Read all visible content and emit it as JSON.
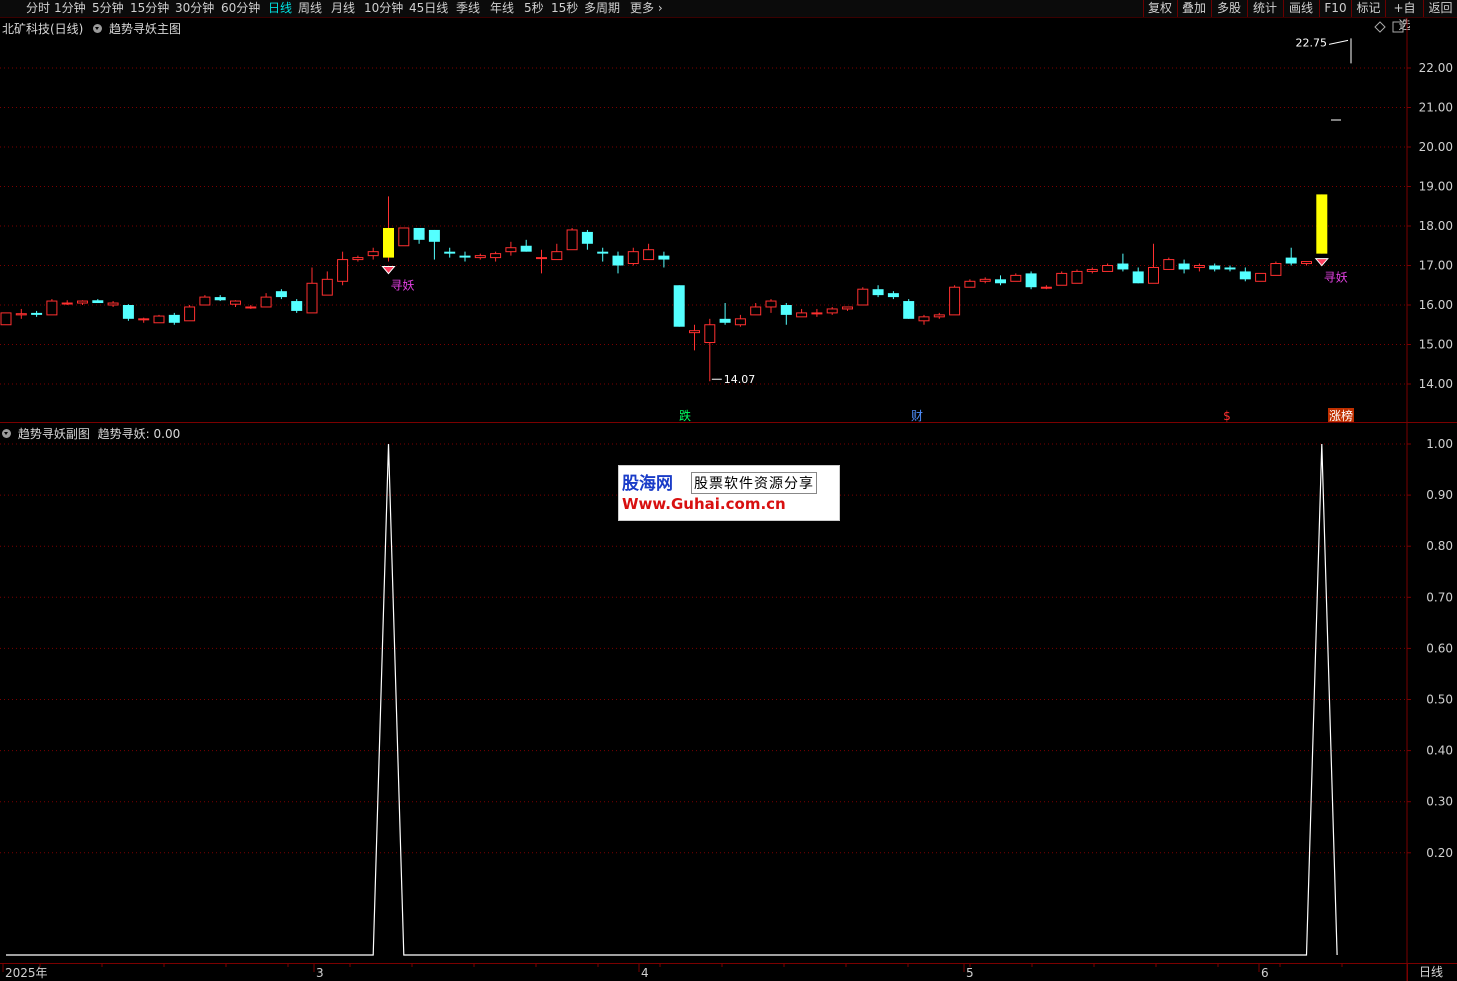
{
  "toolbar": {
    "periods": [
      "分时",
      "1分钟",
      "5分钟",
      "15分钟",
      "30分钟",
      "60分钟",
      "日线",
      "周线",
      "月线",
      "10分钟",
      "45日线",
      "季线",
      "年线",
      "5秒",
      "15秒",
      "多周期",
      "更多"
    ],
    "active_period": "日线",
    "right_buttons": [
      "复权",
      "叠加",
      "多股",
      "统计",
      "画线",
      "F10",
      "标记",
      "+自选",
      "返回"
    ]
  },
  "main_pane": {
    "stock": "北矿科技(日线)",
    "indicator": "趋势寻妖主图",
    "price_axis": [
      "22.00",
      "21.00",
      "20.00",
      "19.00",
      "18.00",
      "17.00",
      "16.00",
      "15.00",
      "14.00"
    ],
    "max_label": "22.75",
    "min_label": "14.07",
    "signal_label": "寻妖",
    "event_markers": [
      "跌",
      "财",
      "$",
      "涨榜"
    ]
  },
  "sub_pane": {
    "indicator": "趋势寻妖副图",
    "value_label": "趋势寻妖: 0.00",
    "value_axis": [
      "1.00",
      "0.90",
      "0.80",
      "0.70",
      "0.60",
      "0.50",
      "0.40",
      "0.30",
      "0.20"
    ]
  },
  "date_axis": [
    "2025年",
    "3",
    "4",
    "5",
    "6"
  ],
  "period_label": "日线",
  "watermark": {
    "brand": "股海网",
    "slogan": "股票软件资源分享",
    "url": "Www.Guhai.com.cn"
  },
  "colors": {
    "up": "#ff3030",
    "down": "#54ffff",
    "signal": "#ffff00",
    "line": "#ffffff",
    "grid": "#7a0000"
  },
  "chart_data": {
    "type": "candlestick",
    "x": [
      "c1",
      "c2",
      "c3",
      "c4",
      "c5",
      "c6",
      "c7",
      "c8",
      "c9",
      "c10",
      "c11",
      "c12",
      "c13",
      "c14",
      "c15",
      "c16",
      "c17",
      "c18",
      "c19",
      "c20",
      "c21",
      "c22",
      "c23",
      "c24",
      "c25",
      "c26",
      "c27",
      "c28",
      "c29",
      "c30",
      "c31",
      "c32",
      "c33",
      "c34",
      "c35",
      "c36",
      "c37",
      "c38",
      "c39",
      "c40",
      "c41",
      "c42",
      "c43",
      "c44",
      "c45",
      "c46",
      "c47",
      "c48",
      "c49",
      "c50",
      "c51",
      "c52",
      "c53",
      "c54",
      "c55",
      "c56",
      "c57",
      "c58",
      "c59",
      "c60",
      "c61",
      "c62",
      "c63",
      "c64",
      "c65",
      "c66",
      "c67",
      "c68",
      "c69",
      "c70",
      "c71",
      "c72",
      "c73",
      "c74",
      "c75",
      "c76",
      "c77",
      "c78",
      "c79",
      "c80",
      "c81"
    ],
    "ohlc": [
      [
        15.5,
        15.8,
        15.5,
        15.8
      ],
      [
        15.75,
        15.9,
        15.65,
        15.78
      ],
      [
        15.8,
        15.85,
        15.7,
        15.75
      ],
      [
        15.75,
        16.15,
        15.75,
        16.1
      ],
      [
        16.05,
        16.12,
        16.0,
        16.05
      ],
      [
        16.05,
        16.12,
        16.0,
        16.1
      ],
      [
        16.12,
        16.15,
        16.05,
        16.05
      ],
      [
        16.0,
        16.1,
        15.95,
        16.05
      ],
      [
        16.0,
        16.02,
        15.6,
        15.65
      ],
      [
        15.65,
        15.68,
        15.55,
        15.65
      ],
      [
        15.55,
        15.75,
        15.55,
        15.72
      ],
      [
        15.75,
        15.8,
        15.5,
        15.55
      ],
      [
        15.6,
        16.0,
        15.6,
        15.95
      ],
      [
        16.0,
        16.25,
        16.0,
        16.2
      ],
      [
        16.2,
        16.25,
        16.1,
        16.12
      ],
      [
        16.02,
        16.12,
        15.95,
        16.1
      ],
      [
        15.95,
        16.0,
        15.9,
        15.95
      ],
      [
        15.95,
        16.3,
        15.95,
        16.2
      ],
      [
        16.35,
        16.4,
        16.15,
        16.2
      ],
      [
        16.1,
        16.15,
        15.8,
        15.85
      ],
      [
        15.8,
        16.95,
        15.8,
        16.55
      ],
      [
        16.25,
        16.85,
        16.25,
        16.65
      ],
      [
        16.6,
        17.35,
        16.5,
        17.15
      ],
      [
        17.15,
        17.25,
        17.1,
        17.2
      ],
      [
        17.25,
        17.45,
        17.15,
        17.35
      ],
      [
        17.2,
        18.75,
        17.1,
        17.95
      ],
      [
        17.5,
        17.95,
        17.5,
        17.95
      ],
      [
        17.95,
        17.95,
        17.55,
        17.65
      ],
      [
        17.9,
        17.9,
        17.15,
        17.6
      ],
      [
        17.35,
        17.45,
        17.2,
        17.3
      ],
      [
        17.25,
        17.35,
        17.1,
        17.2
      ],
      [
        17.2,
        17.3,
        17.15,
        17.25
      ],
      [
        17.2,
        17.35,
        17.1,
        17.3
      ],
      [
        17.35,
        17.6,
        17.25,
        17.45
      ],
      [
        17.5,
        17.65,
        17.35,
        17.35
      ],
      [
        17.2,
        17.4,
        16.8,
        17.2
      ],
      [
        17.15,
        17.55,
        17.15,
        17.35
      ],
      [
        17.4,
        17.95,
        17.4,
        17.9
      ],
      [
        17.85,
        17.9,
        17.4,
        17.55
      ],
      [
        17.35,
        17.45,
        17.1,
        17.3
      ],
      [
        17.25,
        17.35,
        16.8,
        17.0
      ],
      [
        17.05,
        17.45,
        17.0,
        17.35
      ],
      [
        17.15,
        17.55,
        17.15,
        17.4
      ],
      [
        17.25,
        17.35,
        16.95,
        17.15
      ],
      [
        16.5,
        16.5,
        15.45,
        15.45
      ],
      [
        15.3,
        15.5,
        14.85,
        15.35
      ],
      [
        15.05,
        15.65,
        14.07,
        15.5
      ],
      [
        15.65,
        16.05,
        15.5,
        15.55
      ],
      [
        15.5,
        15.75,
        15.45,
        15.65
      ],
      [
        15.75,
        16.05,
        15.75,
        15.95
      ],
      [
        15.95,
        16.15,
        15.8,
        16.1
      ],
      [
        16.0,
        16.05,
        15.5,
        15.75
      ],
      [
        15.7,
        15.9,
        15.7,
        15.8
      ],
      [
        15.8,
        15.9,
        15.7,
        15.8
      ],
      [
        15.8,
        15.95,
        15.75,
        15.9
      ],
      [
        15.9,
        15.95,
        15.85,
        15.95
      ],
      [
        16.0,
        16.45,
        16.0,
        16.4
      ],
      [
        16.4,
        16.5,
        16.2,
        16.25
      ],
      [
        16.3,
        16.35,
        16.15,
        16.2
      ],
      [
        16.1,
        16.15,
        15.65,
        15.65
      ],
      [
        15.6,
        15.75,
        15.5,
        15.7
      ],
      [
        15.7,
        15.8,
        15.65,
        15.75
      ],
      [
        15.75,
        16.5,
        15.75,
        16.45
      ],
      [
        16.45,
        16.65,
        16.45,
        16.6
      ],
      [
        16.6,
        16.7,
        16.55,
        16.65
      ],
      [
        16.65,
        16.75,
        16.5,
        16.55
      ],
      [
        16.6,
        16.8,
        16.6,
        16.75
      ],
      [
        16.8,
        16.85,
        16.4,
        16.45
      ],
      [
        16.45,
        16.5,
        16.4,
        16.45
      ],
      [
        16.5,
        16.85,
        16.5,
        16.8
      ],
      [
        16.55,
        16.9,
        16.55,
        16.85
      ],
      [
        16.85,
        16.95,
        16.8,
        16.9
      ],
      [
        16.85,
        17.05,
        16.85,
        17.0
      ],
      [
        17.05,
        17.3,
        16.85,
        16.9
      ],
      [
        16.85,
        16.95,
        16.55,
        16.55
      ],
      [
        16.55,
        17.55,
        16.55,
        16.95
      ],
      [
        16.9,
        17.2,
        16.9,
        17.15
      ],
      [
        17.05,
        17.15,
        16.8,
        16.9
      ],
      [
        16.95,
        17.05,
        16.85,
        17.0
      ],
      [
        17.0,
        17.05,
        16.85,
        16.9
      ],
      [
        16.95,
        17.0,
        16.85,
        16.9
      ]
    ],
    "extra_bars": [
      [
        16.85,
        16.95,
        16.6,
        16.65
      ],
      [
        16.6,
        16.8,
        16.6,
        16.8
      ],
      [
        16.75,
        17.1,
        16.75,
        17.05
      ],
      [
        17.2,
        17.45,
        17.0,
        17.05
      ],
      [
        17.05,
        17.1,
        17.0,
        17.1
      ],
      [
        17.3,
        18.8,
        17.3,
        18.8
      ]
    ],
    "signal_indices": [
      25,
      86
    ],
    "signal_value": [
      0,
      0,
      0,
      0,
      0,
      0,
      0,
      0,
      0,
      0,
      0,
      0,
      0,
      0,
      0,
      0,
      0,
      0,
      0,
      0,
      0,
      0,
      0,
      0,
      0,
      1,
      0,
      0,
      0,
      0,
      0,
      0,
      0,
      0,
      0,
      0,
      0,
      0,
      0,
      0,
      0,
      0,
      0,
      0,
      0,
      0,
      0,
      0,
      0,
      0,
      0,
      0,
      0,
      0,
      0,
      0,
      0,
      0,
      0,
      0,
      0,
      0,
      0,
      0,
      0,
      0,
      0,
      0,
      0,
      0,
      0,
      0,
      0,
      0,
      0,
      0,
      0,
      0,
      0,
      0,
      0,
      0,
      0,
      0,
      0,
      0,
      1,
      0
    ],
    "price_range": [
      13.5,
      22.8
    ],
    "sub_range": [
      0,
      1.0
    ],
    "y_ticks": [
      14,
      15,
      16,
      17,
      18,
      19,
      20,
      21,
      22
    ],
    "sub_ticks": [
      0.2,
      0.3,
      0.4,
      0.5,
      0.6,
      0.7,
      0.8,
      0.9,
      1.0
    ],
    "max_marker": 22.75,
    "min_marker": 14.07
  }
}
